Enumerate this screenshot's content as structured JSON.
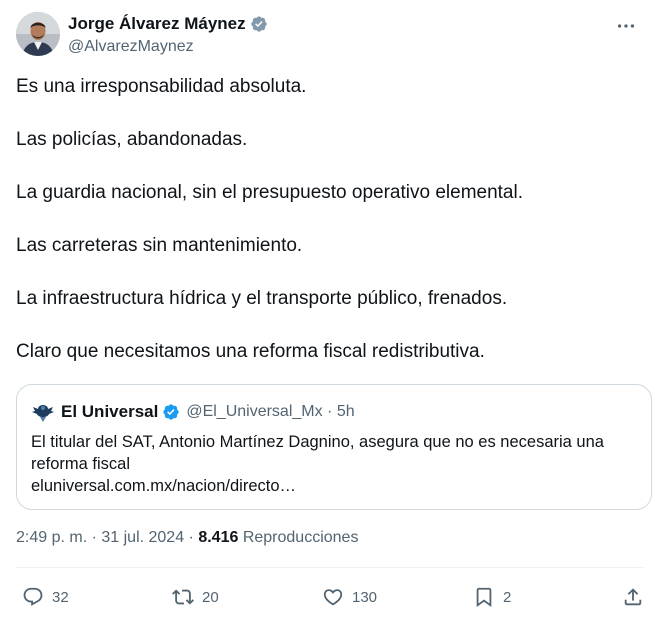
{
  "author": {
    "display_name": "Jorge Álvarez Máynez",
    "handle": "@AlvarezMaynez",
    "avatar_icon": "profile-avatar",
    "verified_icon": "verified-badge-gray"
  },
  "menu_icon": "more-horizontal-icon",
  "tweet": {
    "paragraphs": [
      "Es una irresponsabilidad absoluta.",
      "Las policías, abandonadas.",
      "La guardia nacional, sin el presupuesto operativo elemental.",
      "Las carreteras sin mantenimiento.",
      "La infraestructura hídrica y el transporte público, frenados.",
      "Claro que necesitamos una reforma fiscal redistributiva."
    ]
  },
  "quote": {
    "name": "El Universal",
    "handle_time": "@El_Universal_Mx · 5h",
    "text": "El titular del SAT, Antonio Martínez Dagnino, asegura que no es necesaria una reforma fiscal",
    "link": "eluniversal.com.mx/nacion/directo…",
    "verified_icon": "verified-badge-blue"
  },
  "meta": {
    "time_date": "2:49 p. m. · 31 jul. 2024 · ",
    "views_count": "8.416",
    "views_label": " Reproducciones"
  },
  "actions": {
    "replies": "32",
    "reposts": "20",
    "likes": "130",
    "bookmarks": "2"
  },
  "colors": {
    "text": "#0f1419",
    "secondary": "#536471",
    "border": "#cfd9de",
    "verified_blue": "#1d9bf0",
    "verified_gray": "#829aab"
  }
}
